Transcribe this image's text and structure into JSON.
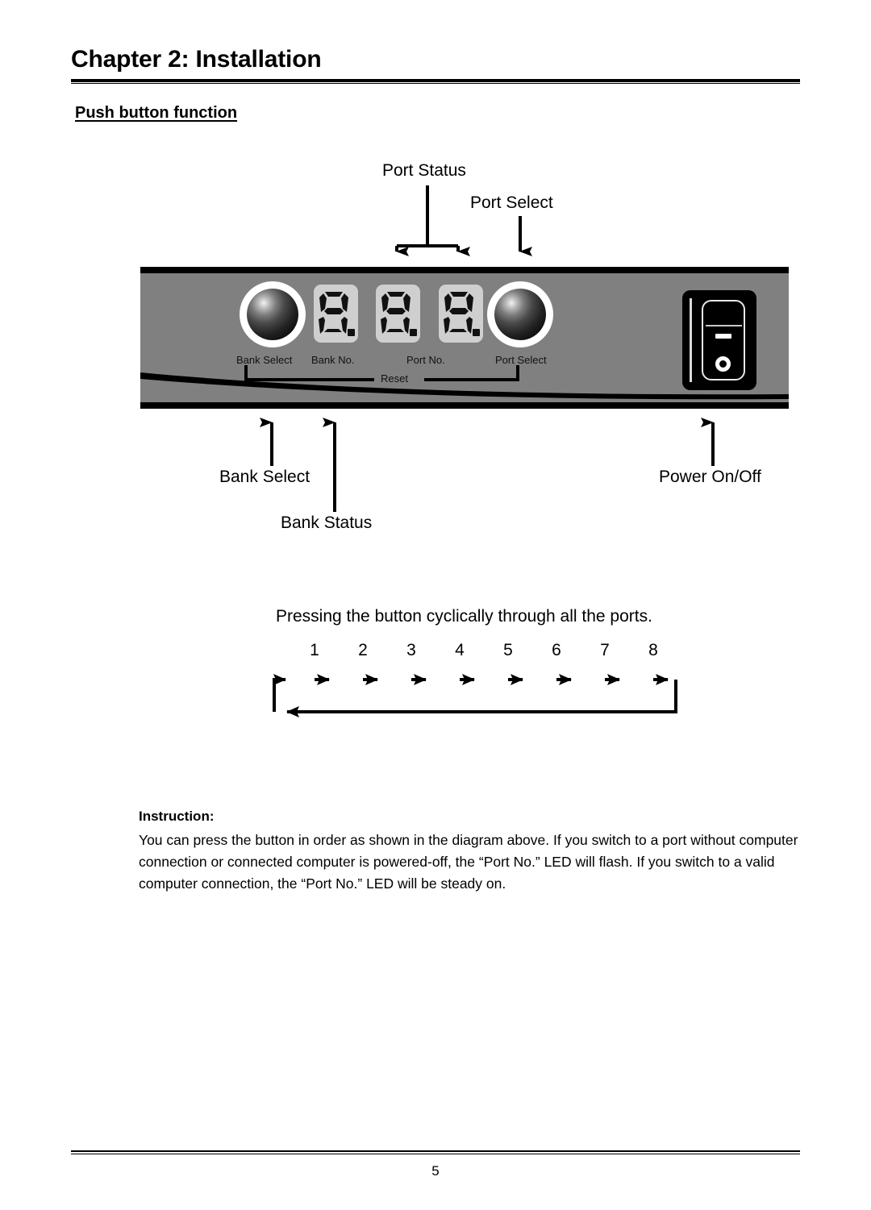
{
  "page": {
    "chapter_title": "Chapter 2: Installation",
    "section_heading": "Push button function",
    "page_number": "5"
  },
  "callouts": {
    "port_status": "Port Status",
    "port_select": "Port Select",
    "bank_select": "Bank Select",
    "bank_status": "Bank Status",
    "power_on_off": "Power On/Off"
  },
  "device_panel": {
    "labels": {
      "bank_select": "Bank Select",
      "bank_no": "Bank No.",
      "port_no": "Port No.",
      "port_select": "Port Select",
      "reset": "Reset"
    },
    "displays": [
      {
        "name": "bank-no-display",
        "value": "8."
      },
      {
        "name": "port-no-display-tens",
        "value": "8."
      },
      {
        "name": "port-no-display-ones",
        "value": "8."
      }
    ],
    "buttons": [
      {
        "name": "bank-select-button"
      },
      {
        "name": "port-select-button"
      }
    ],
    "power_switch": {
      "on_symbol": "—",
      "off_symbol": "○"
    },
    "colors": {
      "panel_face": "#808080",
      "panel_edge": "#000000",
      "display_background": "#cfcfcf",
      "button_ring": "#ffffff"
    }
  },
  "cycle_diagram": {
    "caption": "Pressing the button cyclically through all the ports.",
    "ports": [
      "1",
      "2",
      "3",
      "4",
      "5",
      "6",
      "7",
      "8"
    ]
  },
  "instruction": {
    "title": "Instruction:",
    "body": "You can press the button in order as shown in the diagram above. If you switch to a port without computer connection or connected computer is powered-off, the “Port No.” LED will flash. If you switch to a valid computer connection, the “Port No.” LED will be steady on."
  }
}
